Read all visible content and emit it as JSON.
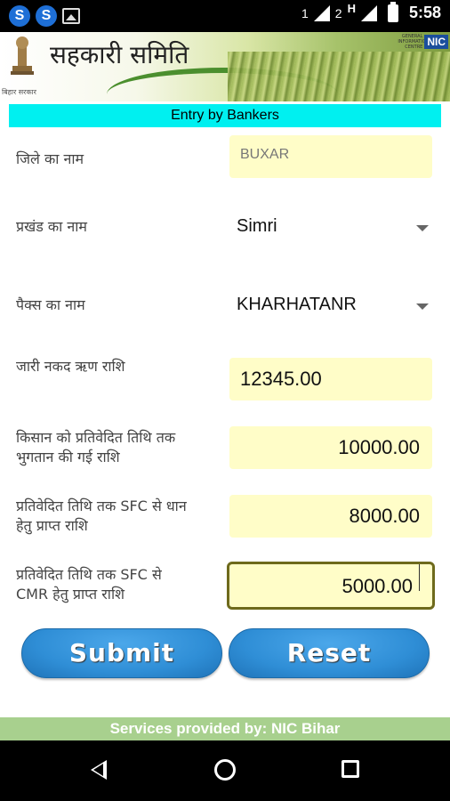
{
  "status_bar": {
    "sim1": "1",
    "sim2": "2",
    "network": "H",
    "time": "5:58",
    "app_icons": [
      "S",
      "S"
    ]
  },
  "banner": {
    "title": "सहकारी समिति",
    "emblem_caption": "बिहार सरकार",
    "nic_logo": "NIC",
    "nic_small": "GENERAL INFORMATICS CENTRE"
  },
  "header": {
    "title": "Entry by Bankers"
  },
  "form": {
    "district_label": "जिले का नाम",
    "district_value": "BUXAR",
    "block_label": "प्रखंड  का  नाम",
    "block_value": "Simri",
    "pacs_label": "पैक्स का नाम",
    "pacs_value": "KHARHATANR",
    "loan_label": "जारी नकद ऋण राशि",
    "loan_value": "12345.00",
    "farmer_label_1": "किसान को प्रतिवेदित तिथि तक",
    "farmer_label_2": "भुगतान की गई राशि",
    "farmer_value": "10000.00",
    "paddy_label_1": "प्रतिवेदित तिथि तक SFC से धान",
    "paddy_label_2": "हेतु प्राप्त राशि",
    "paddy_value": "8000.00",
    "cmr_label_1": "प्रतिवेदित तिथि तक SFC से",
    "cmr_label_2": "CMR हेतु प्राप्त राशि",
    "cmr_value": "5000.00"
  },
  "buttons": {
    "submit": "Submit",
    "reset": "Reset"
  },
  "footer": {
    "text": "Services provided by: NIC Bihar"
  },
  "colors": {
    "header_bg": "#00f0f0",
    "input_bg": "#fffdc8",
    "button_blue": "#2f8ed6",
    "footer_bg": "#a8d08e"
  }
}
